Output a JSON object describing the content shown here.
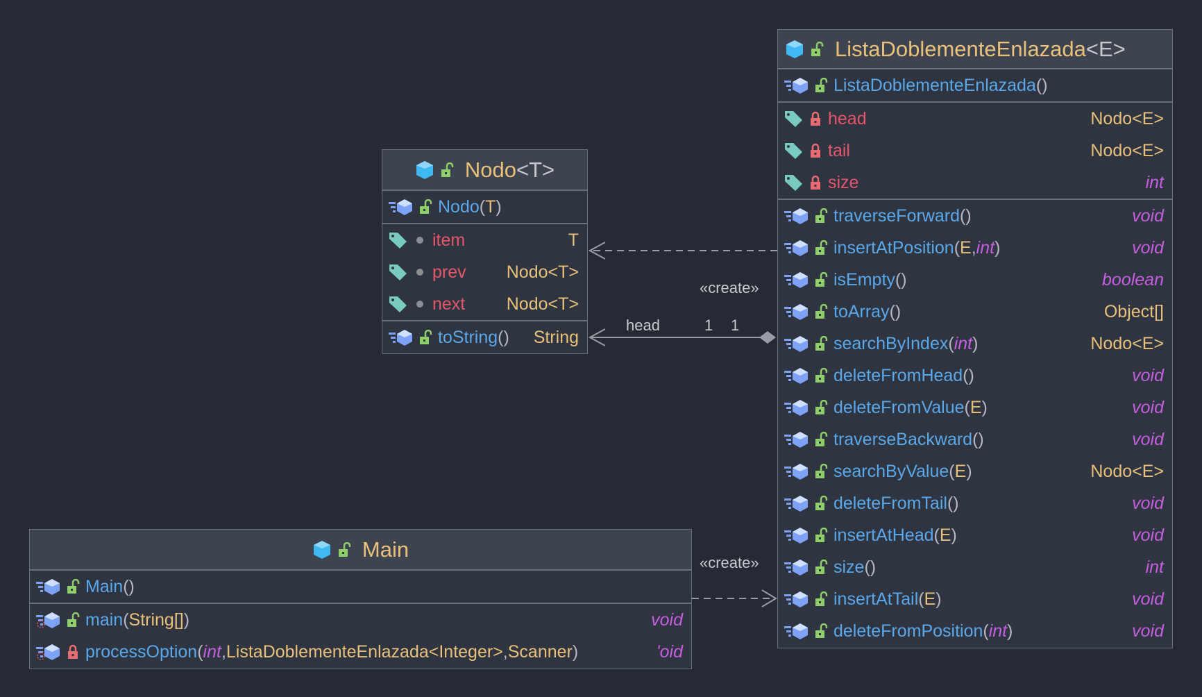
{
  "colors": {
    "background": "#262a34",
    "box": "#2f3441",
    "header": "#3e4350",
    "class_name": "#e9c17b",
    "method": "#5aa8ea",
    "field": "#e5566b",
    "type": "#e8c07a",
    "primitive": "#c65ee0",
    "border": "#6b6f79"
  },
  "classes": {
    "lista": {
      "name": "ListaDoblementeEnlazada",
      "generic": "<E>",
      "constructors": [
        {
          "name": "ListaDoblementeEnlazada",
          "params": [],
          "visibility": "public"
        }
      ],
      "fields": [
        {
          "name": "head",
          "type": "Nodo<E>",
          "type_kind": "type",
          "visibility": "private"
        },
        {
          "name": "tail",
          "type": "Nodo<E>",
          "type_kind": "type",
          "visibility": "private"
        },
        {
          "name": "size",
          "type": "int",
          "type_kind": "prim",
          "visibility": "private"
        }
      ],
      "methods": [
        {
          "name": "traverseForward",
          "params": [],
          "ret": "void",
          "ret_kind": "prim",
          "visibility": "public"
        },
        {
          "name": "insertAtPosition",
          "params": [
            {
              "t": "E",
              "k": "type"
            },
            {
              "t": "int",
              "k": "prim"
            }
          ],
          "ret": "void",
          "ret_kind": "prim",
          "visibility": "public"
        },
        {
          "name": "isEmpty",
          "params": [],
          "ret": "boolean",
          "ret_kind": "prim",
          "visibility": "public"
        },
        {
          "name": "toArray",
          "params": [],
          "ret": "Object[]",
          "ret_kind": "type",
          "visibility": "public"
        },
        {
          "name": "searchByIndex",
          "params": [
            {
              "t": "int",
              "k": "prim"
            }
          ],
          "ret": "Nodo<E>",
          "ret_kind": "type",
          "visibility": "public"
        },
        {
          "name": "deleteFromHead",
          "params": [],
          "ret": "void",
          "ret_kind": "prim",
          "visibility": "public"
        },
        {
          "name": "deleteFromValue",
          "params": [
            {
              "t": "E",
              "k": "type"
            }
          ],
          "ret": "void",
          "ret_kind": "prim",
          "visibility": "public"
        },
        {
          "name": "traverseBackward",
          "params": [],
          "ret": "void",
          "ret_kind": "prim",
          "visibility": "public"
        },
        {
          "name": "searchByValue",
          "params": [
            {
              "t": "E",
              "k": "type"
            }
          ],
          "ret": "Nodo<E>",
          "ret_kind": "type",
          "visibility": "public"
        },
        {
          "name": "deleteFromTail",
          "params": [],
          "ret": "void",
          "ret_kind": "prim",
          "visibility": "public"
        },
        {
          "name": "insertAtHead",
          "params": [
            {
              "t": "E",
              "k": "type"
            }
          ],
          "ret": "void",
          "ret_kind": "prim",
          "visibility": "public"
        },
        {
          "name": "size",
          "params": [],
          "ret": "int",
          "ret_kind": "prim",
          "visibility": "public"
        },
        {
          "name": "insertAtTail",
          "params": [
            {
              "t": "E",
              "k": "type"
            }
          ],
          "ret": "void",
          "ret_kind": "prim",
          "visibility": "public"
        },
        {
          "name": "deleteFromPosition",
          "params": [
            {
              "t": "int",
              "k": "prim"
            }
          ],
          "ret": "void",
          "ret_kind": "prim",
          "visibility": "public"
        }
      ]
    },
    "nodo": {
      "name": "Nodo",
      "generic": "<T>",
      "constructors": [
        {
          "name": "Nodo",
          "params": [
            {
              "t": "T",
              "k": "type"
            }
          ],
          "visibility": "public"
        }
      ],
      "fields": [
        {
          "name": "item",
          "type": "T",
          "type_kind": "type",
          "visibility": "package"
        },
        {
          "name": "prev",
          "type": "Nodo<T>",
          "type_kind": "type",
          "visibility": "package"
        },
        {
          "name": "next",
          "type": "Nodo<T>",
          "type_kind": "type",
          "visibility": "package"
        }
      ],
      "methods": [
        {
          "name": "toString",
          "params": [],
          "ret": "String",
          "ret_kind": "type",
          "visibility": "public"
        }
      ]
    },
    "main": {
      "name": "Main",
      "generic": "",
      "constructors": [
        {
          "name": "Main",
          "params": [],
          "visibility": "public"
        }
      ],
      "fields": [],
      "methods": [
        {
          "name": "main",
          "params": [
            {
              "t": "String[]",
              "k": "type"
            }
          ],
          "ret": "void",
          "ret_kind": "prim",
          "visibility": "public",
          "static": true
        },
        {
          "name": "processOption",
          "params": [
            {
              "t": "int",
              "k": "prim"
            },
            {
              "t": "ListaDoblementeEnlazada<Integer>",
              "k": "type"
            },
            {
              "t": "Scanner",
              "k": "type"
            }
          ],
          "ret": "'oid",
          "ret_kind": "prim",
          "visibility": "private",
          "static": true
        }
      ]
    }
  },
  "relations": {
    "create_1": "«create»",
    "create_2": "«create»",
    "assoc_role": "head",
    "assoc_mult_source": "1",
    "assoc_mult_target": "1"
  }
}
